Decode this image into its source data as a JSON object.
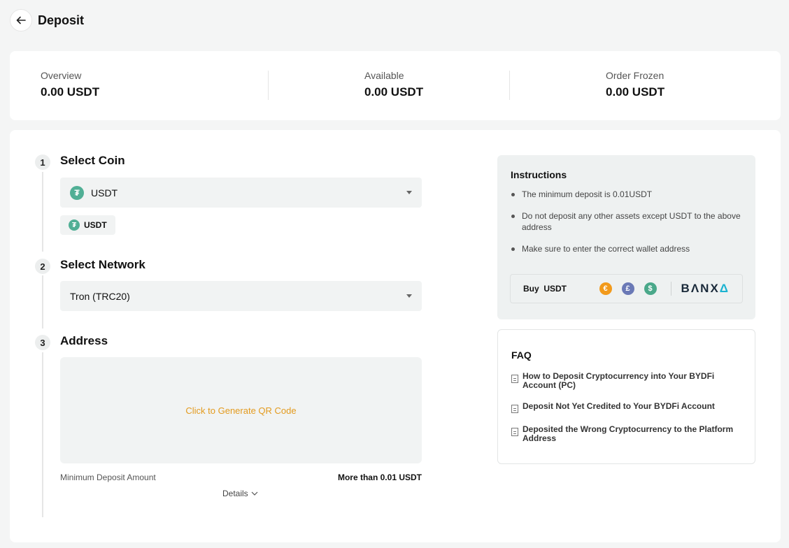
{
  "header": {
    "title": "Deposit"
  },
  "overview": [
    {
      "label": "Overview",
      "value": "0.00 USDT"
    },
    {
      "label": "Available",
      "value": "0.00 USDT"
    },
    {
      "label": "Order Frozen",
      "value": "0.00 USDT"
    }
  ],
  "steps": {
    "coin": {
      "number": "1",
      "title": "Select Coin",
      "selected": "USDT",
      "chip": "USDT"
    },
    "network": {
      "number": "2",
      "title": "Select Network",
      "selected": "Tron (TRC20)"
    },
    "address": {
      "number": "3",
      "title": "Address",
      "qr_link": "Click to Generate QR Code"
    }
  },
  "min_deposit": {
    "label": "Minimum Deposit Amount",
    "value": "More than 0.01 USDT"
  },
  "details_label": "Details",
  "instructions": {
    "title": "Instructions",
    "items": [
      "The minimum deposit is 0.01USDT",
      "Do not deposit any other assets except USDT to the above address",
      "Make sure to enter the correct wallet address"
    ],
    "buy": {
      "label": "Buy  USDT",
      "brand": "BΛNX",
      "brand_tail": "Δ"
    }
  },
  "faq": {
    "title": "FAQ",
    "items": [
      "How to Deposit Cryptocurrency into Your BYDFi Account (PC)",
      "Deposit Not Yet Credited to Your BYDFi Account",
      "Deposited the Wrong Cryptocurrency to the Platform Address"
    ]
  },
  "colors": {
    "accent": "#e39a1d",
    "tether": "#50af95"
  }
}
